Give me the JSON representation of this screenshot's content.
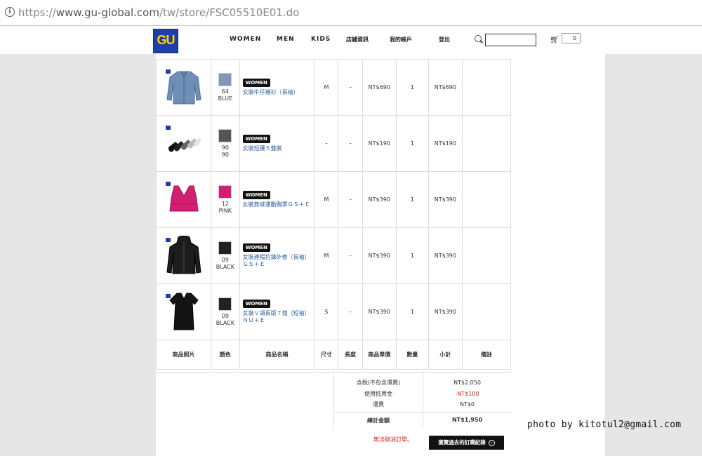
{
  "browser": {
    "url_prefix": "https://",
    "url_host": "www.gu-global.com",
    "url_path": "/tw/store/FSC05510E01.do"
  },
  "header": {
    "logo": "GU",
    "nav": [
      "WOMEN",
      "MEN",
      "KIDS",
      "店鋪資訊",
      "我的帳戶",
      "登出"
    ],
    "cart_count": "0",
    "search_placeholder": ""
  },
  "order_items": [
    {
      "badge": "WOMEN",
      "name": "女裝牛仔襯衫（長袖）",
      "color_code": "64",
      "color_name": "BLUE",
      "swatch": "#7f98b8",
      "size": "M",
      "length": "–",
      "price": "NT$690",
      "qty": "1",
      "subtotal": "NT$690",
      "icon": "denim-shirt-icon"
    },
    {
      "badge": "WOMEN",
      "name": "女裝短襪５雙裝",
      "color_code": "90",
      "color_name": "90",
      "swatch": "#555555",
      "size": "–",
      "length": "–",
      "price": "NT$190",
      "qty": "1",
      "subtotal": "NT$190",
      "icon": "socks-icon"
    },
    {
      "badge": "WOMEN",
      "name": "女裝無縫運動胸罩ＧＳ＋Ｅ",
      "color_code": "12",
      "color_name": "PINK",
      "swatch": "#d21f6e",
      "size": "M",
      "length": "–",
      "price": "NT$390",
      "qty": "1",
      "subtotal": "NT$390",
      "icon": "sports-bra-icon"
    },
    {
      "badge": "WOMEN",
      "name": "女裝連帽拉鍊外套（長袖）ＧＳ＋Ｅ",
      "color_code": "09",
      "color_name": "BLACK",
      "swatch": "#222222",
      "size": "M",
      "length": "–",
      "price": "NT$390",
      "qty": "1",
      "subtotal": "NT$390",
      "icon": "hooded-jacket-icon"
    },
    {
      "badge": "WOMEN",
      "name": "女裝Ｖ領長版Ｔ恤（短袖）ＮＵ＋Ｅ",
      "color_code": "09",
      "color_name": "BLACK",
      "swatch": "#222222",
      "size": "S",
      "length": "–",
      "price": "NT$390",
      "qty": "1",
      "subtotal": "NT$390",
      "icon": "long-tshirt-icon"
    }
  ],
  "table_headers": [
    "商品照片",
    "顏色",
    "商品名稱",
    "尺寸",
    "長度",
    "商品單價",
    "數量",
    "小計",
    "備註"
  ],
  "summary": {
    "tax_label": "含稅(不包含運費)",
    "tax_value": "NT$2,050",
    "credit_label": "使用抵用金",
    "credit_value": "-NT$100",
    "shipping_label": "運費",
    "shipping_value": "NT$0",
    "total_label": "總計金額",
    "total_value": "NT$1,950"
  },
  "footer": {
    "warning": "無法取消訂單。",
    "history_button": "瀏覽過去的訂購紀錄"
  },
  "watermark": "photo by kitotul2@gmail.com",
  "colors": {
    "accent": "#2a5d9f",
    "warning": "#e02020",
    "brand": "#1f3fa6",
    "background": "#e6e6e6"
  }
}
